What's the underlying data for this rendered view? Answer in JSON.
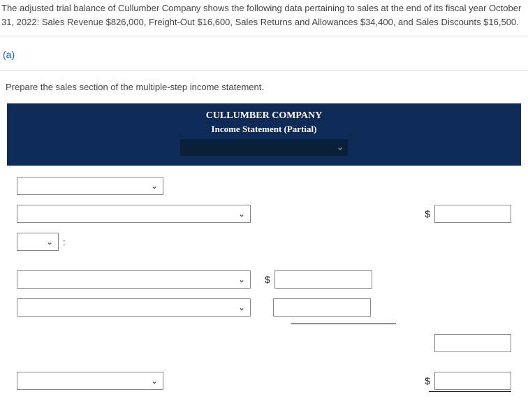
{
  "problem": "The adjusted trial balance of Cullumber Company shows the following data pertaining to sales at the end of its fiscal year October 31, 2022: Sales Revenue $826,000, Freight-Out $16,600, Sales Returns and Allowances $34,400, and Sales Discounts $16,500.",
  "part_label": "(a)",
  "instruction": "Prepare the sales section of the multiple-step income statement.",
  "header": {
    "company": "CULLUMBER COMPANY",
    "subtitle": "Income Statement (Partial)",
    "period_select": ""
  },
  "rows": {
    "r1_select": "",
    "r2_select": "",
    "r2_amount": "",
    "r3_select": "",
    "r3_colon": ":",
    "r4_select": "",
    "r4_amount": "",
    "r5_select": "",
    "r5_amount": "",
    "r6_amount": "",
    "r7_select": "",
    "r7_amount": ""
  },
  "symbols": {
    "dollar": "$",
    "chevron": "⌄"
  }
}
